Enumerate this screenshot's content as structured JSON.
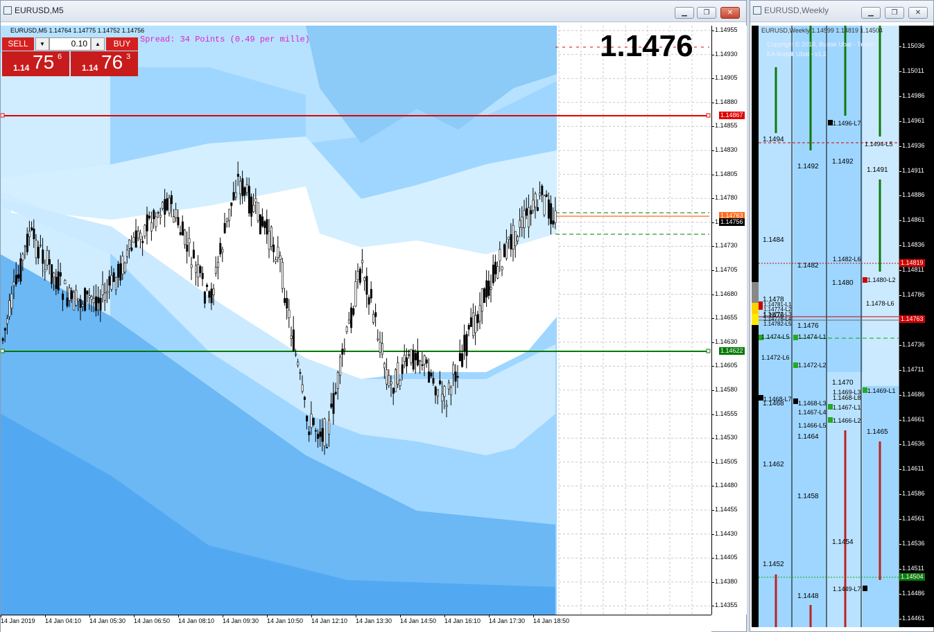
{
  "main_window": {
    "title": "EURUSD,M5",
    "info_line": "EURUSD,M5  1.14764 1.14775 1.14752 1.14756",
    "spread_text": "Spread: 34 Points (0.49 per mille)",
    "big_price": "1.1476",
    "trade_panel": {
      "sell_label": "SELL",
      "buy_label": "BUY",
      "lot_value": "0.10",
      "sell_price_small": "1.14",
      "sell_price_big": "75",
      "sell_price_sup": "6",
      "buy_price_small": "1.14",
      "buy_price_big": "76",
      "buy_price_sup": "3"
    },
    "price_axis": [
      "1.14955",
      "1.14930",
      "1.14905",
      "1.14880",
      "1.14855",
      "1.14830",
      "1.14805",
      "1.14780",
      "1.14755",
      "1.14730",
      "1.14705",
      "1.14680",
      "1.14655",
      "1.14630",
      "1.14605",
      "1.14580",
      "1.14555",
      "1.14530",
      "1.14505",
      "1.14480",
      "1.14455",
      "1.14430",
      "1.14405",
      "1.14380",
      "1.14355"
    ],
    "time_axis": [
      "14 Jan 2019",
      "14 Jan 04:10",
      "14 Jan 05:30",
      "14 Jan 06:50",
      "14 Jan 08:10",
      "14 Jan 09:30",
      "14 Jan 10:50",
      "14 Jan 12:10",
      "14 Jan 13:30",
      "14 Jan 14:50",
      "14 Jan 16:10",
      "14 Jan 17:30",
      "14 Jan 18:50"
    ],
    "level_badges": {
      "red_line": "1.14867",
      "ask": "1.14763",
      "bid": "1.14756",
      "green_line": "1.14622"
    },
    "colors": {
      "red_line": "#e00000",
      "green_line": "#007a00",
      "ask": "#ff6a1a",
      "bid": "#000000"
    }
  },
  "weekly_window": {
    "title": "EURUSD,Weekly",
    "info_line": "EURUSD,Weekly  1.14599 1.14819 1.14504",
    "copyright": "Copyright © 2018, Budak Ubat - Trader",
    "ea_name": "EA Budak Ubat - v1.2",
    "price_axis": [
      "1.15036",
      "1.15011",
      "1.14986",
      "1.14961",
      "1.14936",
      "1.14911",
      "1.14886",
      "1.14861",
      "1.14836",
      "1.14811",
      "1.14786",
      "1.14761",
      "1.14736",
      "1.14711",
      "1.14686",
      "1.14661",
      "1.14636",
      "1.14611",
      "1.14586",
      "1.14561",
      "1.14536",
      "1.14511",
      "1.14486",
      "1.14461"
    ],
    "badges": {
      "high": "1.14819",
      "current": "1.14763",
      "low": "1.14504"
    },
    "col1_levels": [
      "1.1494",
      "1.1484",
      "1.1478",
      "1.1476",
      "1.1472-L6",
      "1.1474-L5",
      "1.1468-L7",
      "1.1468",
      "1.1462",
      "1.1452"
    ],
    "col2_levels": [
      "1.1492",
      "1.1482",
      "1.1476",
      "1.1474-L1",
      "1.1472-L2",
      "1.1468-L3",
      "1.1467-L4",
      "1.1466-L5",
      "1.1464",
      "1.1458",
      "1.1448"
    ],
    "col3_levels": [
      "1.1496-L7",
      "1.1492",
      "1.1482-L6",
      "1.1480",
      "1.1470",
      "1.1469-L3",
      "1.1468-L8",
      "1.1467-L1",
      "1.1466-L2",
      "1.1454",
      "1.1449-L7"
    ],
    "col4_levels": [
      "1.1494-L5",
      "1.1491",
      "1.1480-L2",
      "1.1478-L6",
      "1.1469-L1",
      "1.1465"
    ],
    "extra_labels": [
      "1.14781-L1",
      "1.14774-L2",
      "1.14772-L3",
      "1.14778-L4",
      "1.14782-L5"
    ]
  }
}
